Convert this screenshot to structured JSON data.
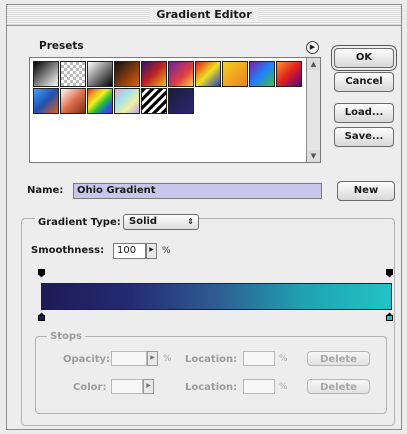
{
  "window": {
    "title": "Gradient Editor"
  },
  "presets": {
    "label": "Presets",
    "menu_icon": "circle-arrow-icon",
    "swatches": [
      "linear-gradient(135deg,#000 0%,#fff 100%)",
      "repeating-conic-gradient(#bbb 0 25%, #fff 0 50%) 0 0/6px 6px",
      "linear-gradient(135deg,#fff 0%,#000 100%)",
      "linear-gradient(135deg,#111 0%,#e06010 100%)",
      "linear-gradient(135deg,#2a1a6a 0%,#c02020 50%,#f0c020 100%)",
      "linear-gradient(135deg,#6a20a0 0%,#e04040 60%,#ffd040 100%)",
      "linear-gradient(135deg,#e02020 0%,#f0e020 50%,#2040c0 100%)",
      "linear-gradient(135deg,#f0d020 0%,#f08020 100%)",
      "linear-gradient(135deg,#8020a0 0%,#2080ff 50%,#40c040 100%)",
      "linear-gradient(135deg,#ff9030 0%,#e02020 50%,#600080 100%)",
      "linear-gradient(135deg,#40a0ff 0%,#2050b0 50%,#e06020 100%)",
      "linear-gradient(135deg,#fff 0%,#e07050 50%,#7a3010 100%)",
      "linear-gradient(135deg,#e03030,#f0a020,#f0f020,#30c030,#2060e0,#8020c0)",
      "linear-gradient(135deg,#f0a0c0,#a0e0f0,#f0f0a0,#c0a0f0)",
      "repeating-linear-gradient(135deg,#000 0 3px,#fff 3px 6px)",
      "linear-gradient(135deg,#1a1a40 0%,#2a2a70 100%)"
    ]
  },
  "buttons": {
    "ok": "OK",
    "cancel": "Cancel",
    "load": "Load...",
    "save": "Save...",
    "new": "New"
  },
  "name": {
    "label": "Name:",
    "value": "Ohio Gradient"
  },
  "gradient_type": {
    "label": "Gradient Type:",
    "value": "Solid"
  },
  "smoothness": {
    "label": "Smoothness:",
    "value": "100",
    "unit": "%"
  },
  "gradient": {
    "colors": [
      "#1c1b55",
      "#252a72",
      "#2f5c93",
      "#1fa3b0",
      "#22c2c4"
    ],
    "opacity_stops": 2,
    "color_stops": 2
  },
  "stops": {
    "group_label": "Stops",
    "opacity_label": "Opacity:",
    "color_label": "Color:",
    "location_label_1": "Location:",
    "location_label_2": "Location:",
    "unit_1": "%",
    "unit_2": "%",
    "unit_3": "%",
    "delete_1": "Delete",
    "delete_2": "Delete"
  }
}
